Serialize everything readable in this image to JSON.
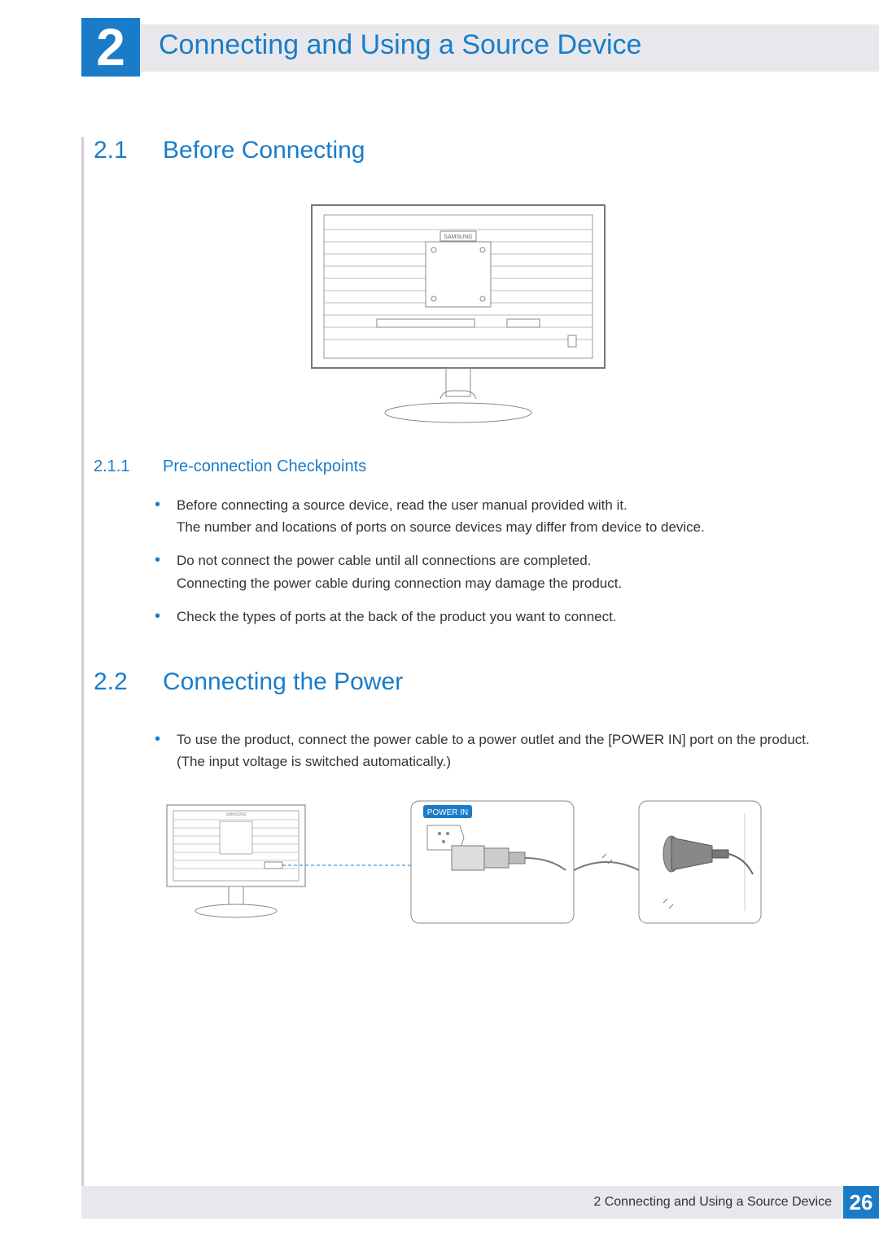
{
  "chapter": {
    "number": "2",
    "title": "Connecting and Using a Source Device"
  },
  "sections": {
    "s1": {
      "num": "2.1",
      "title": "Before Connecting"
    },
    "s1_1": {
      "num": "2.1.1",
      "title": "Pre-connection Checkpoints"
    },
    "s2": {
      "num": "2.2",
      "title": "Connecting the Power"
    }
  },
  "bullets_211": [
    "Before connecting a source device, read the user manual provided with it.\nThe number and locations of ports on source devices may differ from device to device.",
    "Do not connect the power cable until all connections are completed.\nConnecting the power cable during connection may damage the product.",
    "Check the types of ports at the back of the product you want to connect."
  ],
  "bullets_22": [
    "To use the product, connect the power cable to a power outlet and the [POWER IN] port on the product.(The input voltage is switched automatically.)"
  ],
  "illustration": {
    "brand_label": "SAMSUNG",
    "power_label": "POWER IN"
  },
  "footer": {
    "text": "2 Connecting and Using a Source Device",
    "page": "26"
  }
}
